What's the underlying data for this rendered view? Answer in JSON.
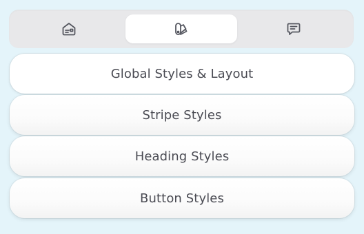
{
  "tabs": [
    {
      "icon": "home-mail-icon",
      "active": false
    },
    {
      "icon": "swatches-icon",
      "active": true
    },
    {
      "icon": "message-icon",
      "active": false
    }
  ],
  "sections": [
    {
      "label": "Global Styles & Layout"
    },
    {
      "label": "Stripe Styles"
    },
    {
      "label": "Heading Styles"
    },
    {
      "label": "Button Styles"
    }
  ],
  "colors": {
    "background": "#e4f4fa",
    "tabbar": "#e8e8ea",
    "icon": "#555760",
    "text": "#4a4b53"
  }
}
